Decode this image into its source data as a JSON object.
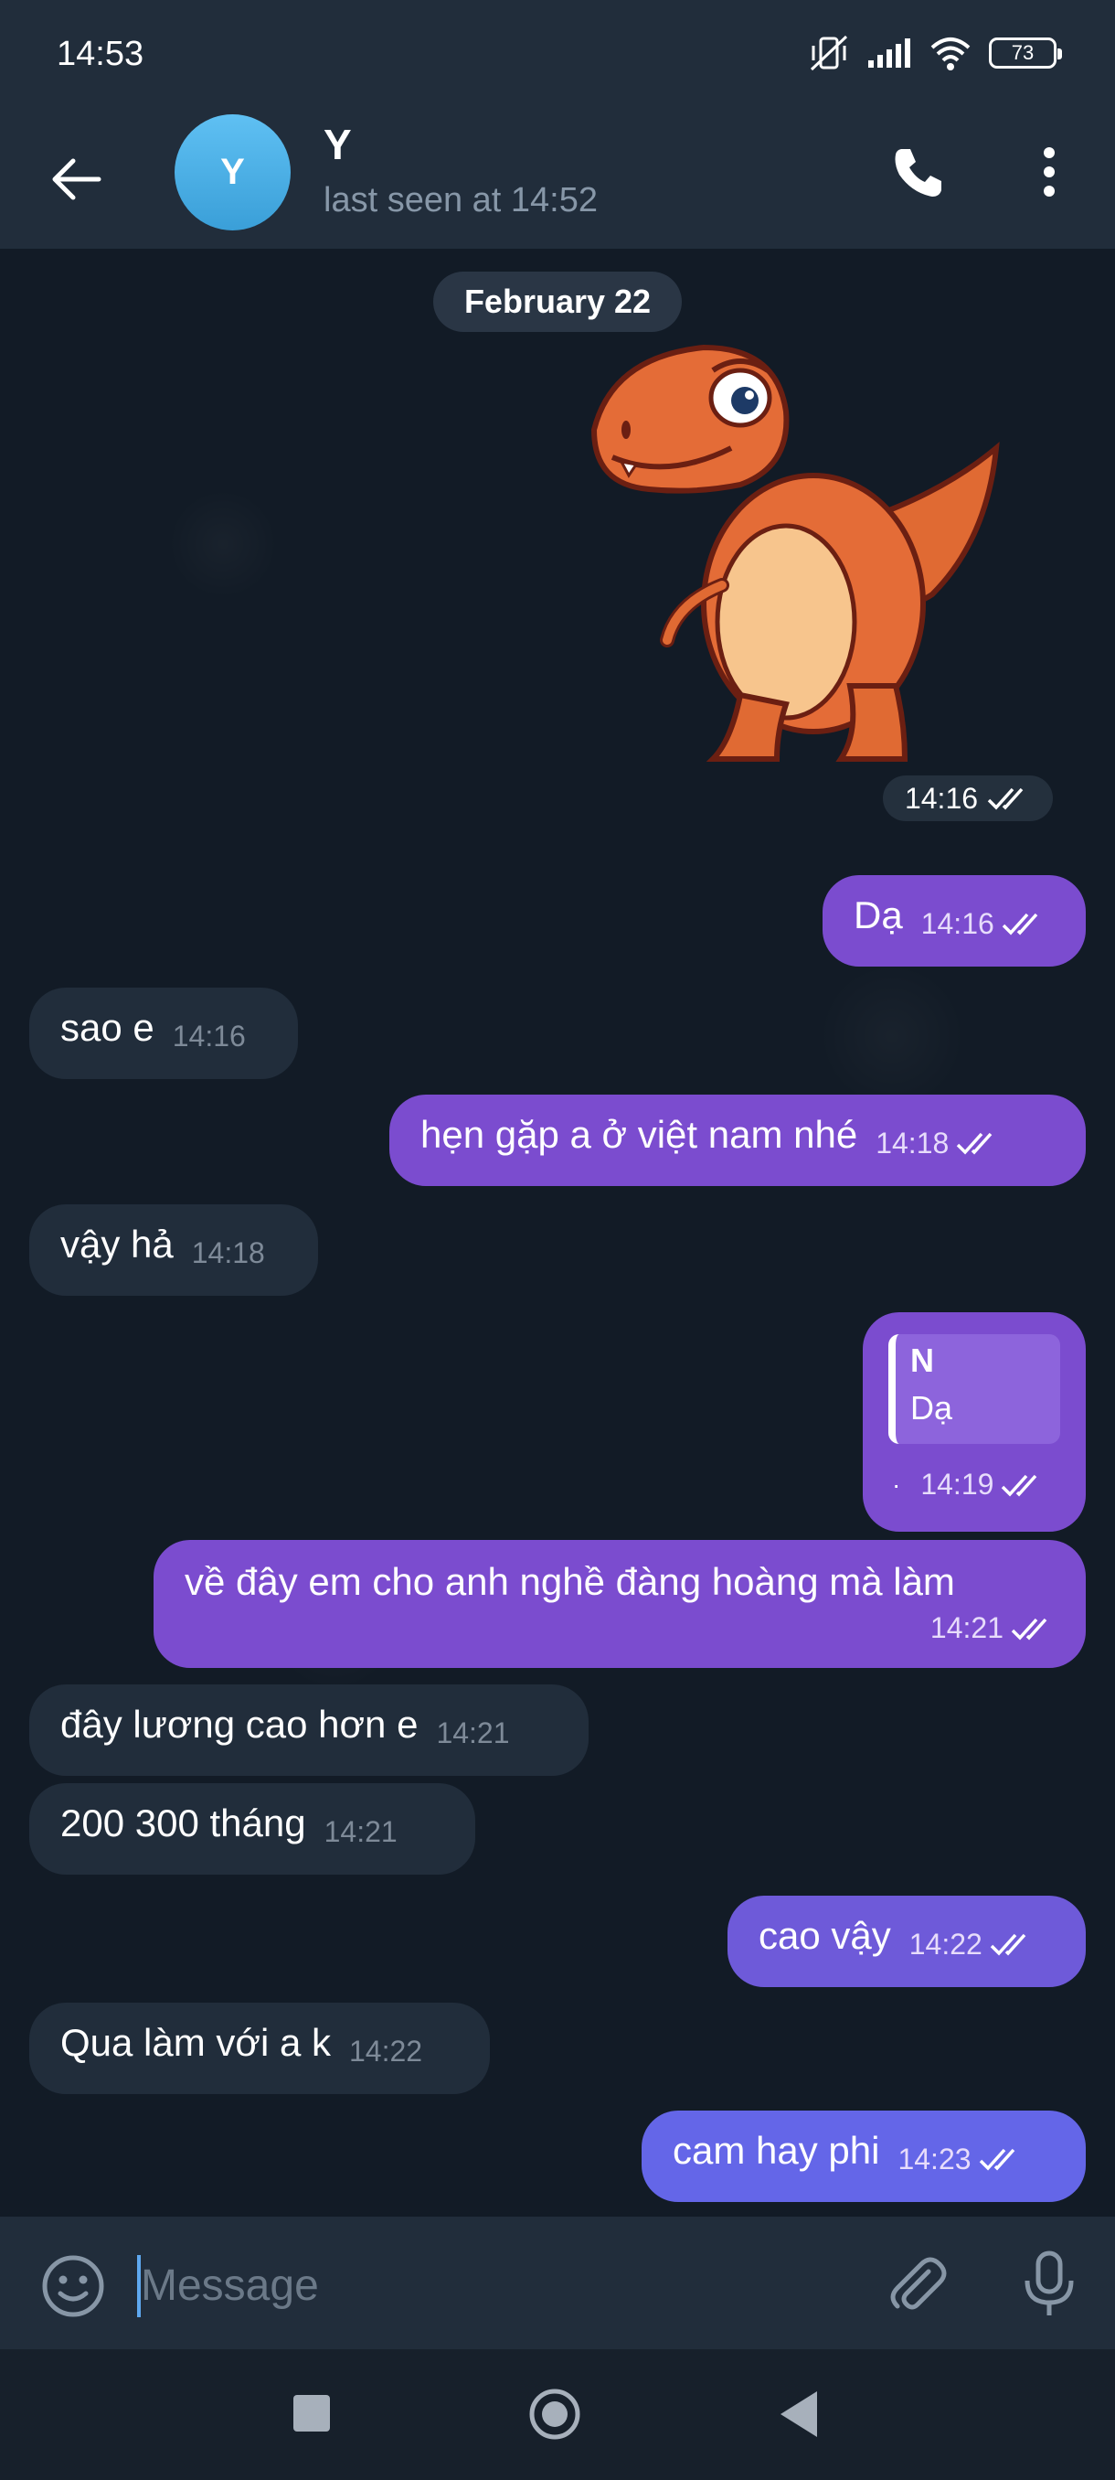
{
  "status_bar": {
    "time": "14:53",
    "battery": "73"
  },
  "header": {
    "avatar_letter": "Y",
    "contact_name": "Y",
    "contact_status": "last seen at 14:52"
  },
  "chat": {
    "date_chip": "February 22",
    "sticker_time": "14:16",
    "messages": [
      {
        "direction": "out",
        "text": "Dạ",
        "time": "14:16"
      },
      {
        "direction": "in",
        "text": "sao e",
        "time": "14:16"
      },
      {
        "direction": "out",
        "text": "hẹn gặp a ở việt nam nhé",
        "time": "14:18"
      },
      {
        "direction": "in",
        "text": "vậy hả",
        "time": "14:18"
      },
      {
        "direction": "out",
        "reply_author": "N",
        "reply_text": "Dạ",
        "text": "·",
        "time": "14:19"
      },
      {
        "direction": "out",
        "text": "về đây em cho anh nghề đàng hoàng mà làm",
        "time": "14:21"
      },
      {
        "direction": "in",
        "text": "đây lương cao hơn e",
        "time": "14:21"
      },
      {
        "direction": "in",
        "text": "200 300 tháng",
        "time": "14:21"
      },
      {
        "direction": "out",
        "text": "cao vậy",
        "time": "14:22"
      },
      {
        "direction": "in",
        "text": "Qua làm với a k",
        "time": "14:22"
      },
      {
        "direction": "out",
        "text": "cam hay phi",
        "time": "14:23"
      }
    ]
  },
  "composer": {
    "placeholder": "Message"
  },
  "colors": {
    "header_bg": "#212d3b",
    "incoming_bubble": "#212d3b",
    "outgoing_bubble": "#7b4ccf",
    "avatar": "#4db0e8"
  },
  "icons": [
    "back-arrow-icon",
    "phone-icon",
    "more-vertical-icon",
    "emoji-icon",
    "paperclip-icon",
    "microphone-icon",
    "double-check-icon"
  ]
}
